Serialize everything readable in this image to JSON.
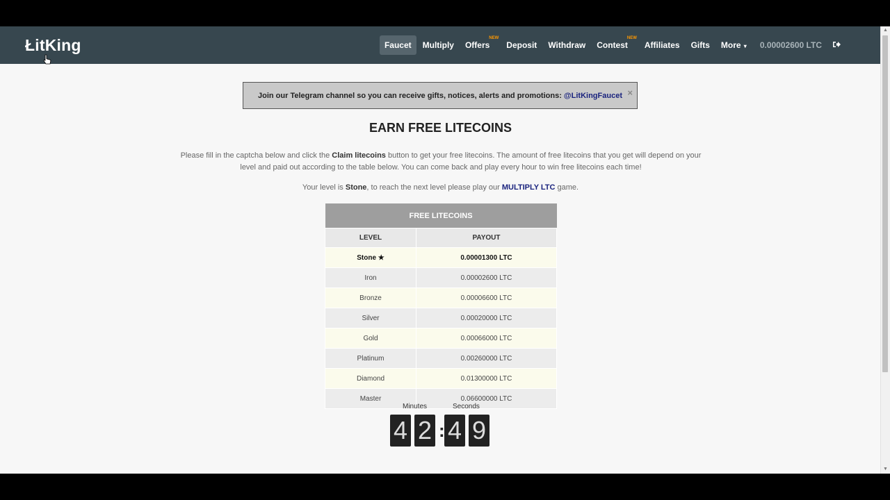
{
  "navbar": {
    "brand": "ŁitKing",
    "items": [
      {
        "label": "Faucet",
        "active": true,
        "badge": ""
      },
      {
        "label": "Multiply",
        "active": false,
        "badge": ""
      },
      {
        "label": "Offers",
        "active": false,
        "badge": "NEW"
      },
      {
        "label": "Deposit",
        "active": false,
        "badge": ""
      },
      {
        "label": "Withdraw",
        "active": false,
        "badge": ""
      },
      {
        "label": "Contest",
        "active": false,
        "badge": "NEW"
      },
      {
        "label": "Affiliates",
        "active": false,
        "badge": ""
      },
      {
        "label": "Gifts",
        "active": false,
        "badge": ""
      },
      {
        "label": "More",
        "active": false,
        "badge": ""
      }
    ],
    "balance": "0.00002600 LTC",
    "logout_icon": "sign-out-icon"
  },
  "notice": {
    "text": "Join our Telegram channel so you can receive gifts, notices, alerts and promotions: ",
    "link": "@LitKingFaucet",
    "close": "×"
  },
  "main": {
    "title": "EARN FREE LITECOINS",
    "para_1": "Please fill in the captcha below and click the ",
    "para_bold": "Claim litecoins",
    "para_2": " button to get your free litecoins. The amount of free litecoins that you get will depend on your level and paid out according to the table below. You can come back and play every hour to win free litecoins each time!",
    "level_1": "Your level is ",
    "level_name": "Stone",
    "level_2": ", to reach the next level please play our ",
    "level_link": "MULTIPLY LTC",
    "level_3": " game."
  },
  "table": {
    "title": "FREE LITECOINS",
    "headers": [
      "LEVEL",
      "PAYOUT"
    ],
    "rows": [
      {
        "level": "Stone",
        "payout": "0.00001300 LTC",
        "current": true
      },
      {
        "level": "Iron",
        "payout": "0.00002600 LTC",
        "current": false
      },
      {
        "level": "Bronze",
        "payout": "0.00006600 LTC",
        "current": false
      },
      {
        "level": "Silver",
        "payout": "0.00020000 LTC",
        "current": false
      },
      {
        "level": "Gold",
        "payout": "0.00066000 LTC",
        "current": false
      },
      {
        "level": "Platinum",
        "payout": "0.00260000 LTC",
        "current": false
      },
      {
        "level": "Diamond",
        "payout": "0.01300000 LTC",
        "current": false
      },
      {
        "level": "Master",
        "payout": "0.06600000 LTC",
        "current": false
      }
    ]
  },
  "timer": {
    "minutes_label": "Minutes",
    "seconds_label": "Seconds",
    "digits": [
      "4",
      "2",
      "4",
      "9"
    ],
    "separator": ":"
  }
}
